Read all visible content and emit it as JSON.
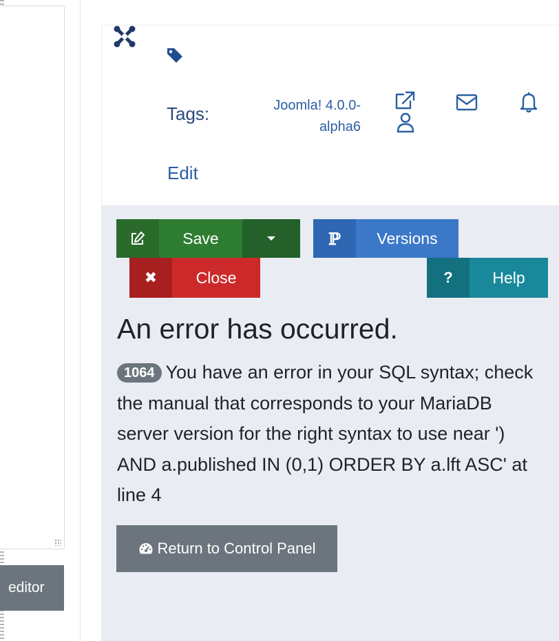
{
  "left": {
    "editor_button": "editor"
  },
  "header": {
    "tags_label": "Tags:",
    "version_line1": "Joomla! 4.0.0-",
    "version_line2": "alpha6",
    "edit_label": "Edit"
  },
  "toolbar": {
    "save_label": "Save",
    "versions_label": "Versions",
    "close_label": "Close",
    "help_label": "Help",
    "help_icon": "?",
    "close_icon": "✖",
    "versions_icon": "ℙ"
  },
  "error": {
    "title": "An error has occurred.",
    "code": "1064",
    "message": "You have an error in your SQL syntax; check the manual that corresponds to your MariaDB server version for the right syntax to use near ') AND a.published IN (0,1) ORDER BY a.lft ASC' at line 4"
  },
  "return_button": {
    "label": "Return to Control Panel"
  },
  "colors": {
    "save": "#2e7d32",
    "versions": "#3b78c8",
    "close": "#cc2a2a",
    "help": "#18889a",
    "secondary": "#6c757d",
    "link": "#2a5fa3"
  },
  "icons": [
    "joomla-logo",
    "tag-icon",
    "external-link-icon",
    "user-icon",
    "mail-icon",
    "bell-icon",
    "edit-icon",
    "caret-down-icon",
    "branch-icon",
    "close-icon",
    "help-icon",
    "dashboard-icon"
  ]
}
